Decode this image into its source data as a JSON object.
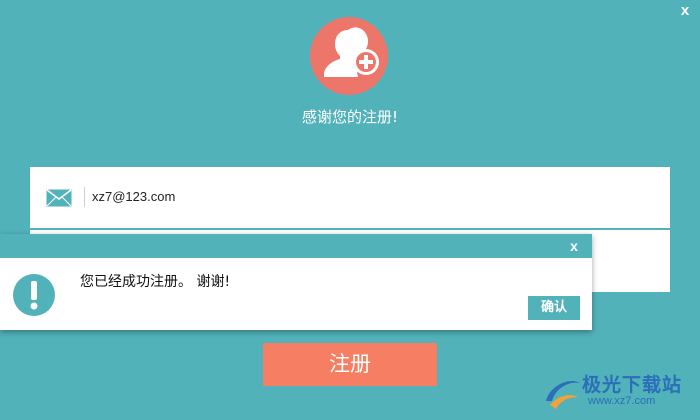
{
  "window": {
    "close_label": "x"
  },
  "header": {
    "thanks_text": "感谢您的注册!"
  },
  "form": {
    "email_value": "xz7@123.com",
    "submit_label": "注册"
  },
  "dialog": {
    "close_label": "x",
    "message": "您已经成功注册。 谢谢!",
    "ok_label": "确认"
  },
  "watermark": {
    "brand": "极光下载站",
    "url": "www.xz7.com"
  },
  "colors": {
    "background": "#52b2ba",
    "avatar": "#ec766a",
    "button": "#f67f63"
  },
  "icons": [
    "add-user-icon",
    "mail-icon",
    "alert-icon",
    "close-icon"
  ]
}
